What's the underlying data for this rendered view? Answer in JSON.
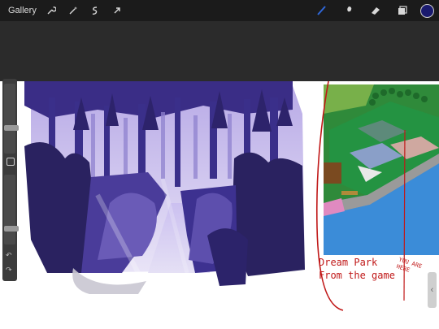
{
  "toolbar": {
    "gallery_label": "Gallery",
    "left_icons": [
      "wrench-icon",
      "magic-wand-icon",
      "selection-icon",
      "transform-arrow-icon"
    ],
    "right_icons": [
      "brush-icon",
      "smudge-icon",
      "eraser-icon",
      "layers-icon"
    ],
    "brush_color": "#2f67d8",
    "current_color": "#1a1a6e"
  },
  "sidebar": {
    "size_slider_value": 0.35,
    "opacity_slider_value": 0.2
  },
  "canvas": {
    "annotation_line1": "Dream Park",
    "annotation_line2": "From the game",
    "annotation_here": "YOU ARE HERE"
  },
  "colors": {
    "ui_dark": "#1b1b1b",
    "canvas_bg": "#ffffff",
    "purple_dark": "#2a2260",
    "annotation_red": "#c01818"
  }
}
